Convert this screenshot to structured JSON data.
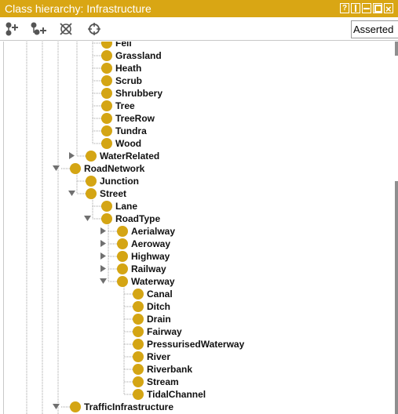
{
  "window": {
    "title": "Class hierarchy: Infrastructure"
  },
  "toolbar": {
    "add_subclass_icon": "add-subclass-icon",
    "add_sibling_icon": "add-sibling-icon",
    "delete_class_icon": "delete-class-icon",
    "find_icon": "crosshair-icon",
    "mode_value": "Asserted"
  },
  "colors": {
    "title_bar": "#d9a614",
    "class_icon": "#d4a514"
  },
  "tree": {
    "rows": [
      {
        "label": "Fell",
        "depth": 3,
        "toggle": "none"
      },
      {
        "label": "Grassland",
        "depth": 3,
        "toggle": "none"
      },
      {
        "label": "Heath",
        "depth": 3,
        "toggle": "none"
      },
      {
        "label": "Scrub",
        "depth": 3,
        "toggle": "none"
      },
      {
        "label": "Shrubbery",
        "depth": 3,
        "toggle": "none"
      },
      {
        "label": "Tree",
        "depth": 3,
        "toggle": "none"
      },
      {
        "label": "TreeRow",
        "depth": 3,
        "toggle": "none"
      },
      {
        "label": "Tundra",
        "depth": 3,
        "toggle": "none"
      },
      {
        "label": "Wood",
        "depth": 3,
        "toggle": "none"
      },
      {
        "label": "WaterRelated",
        "depth": 2,
        "toggle": "collapsed"
      },
      {
        "label": "RoadNetwork",
        "depth": 1,
        "toggle": "expanded"
      },
      {
        "label": "Junction",
        "depth": 2,
        "toggle": "none"
      },
      {
        "label": "Street",
        "depth": 2,
        "toggle": "expanded"
      },
      {
        "label": "Lane",
        "depth": 3,
        "toggle": "none"
      },
      {
        "label": "RoadType",
        "depth": 3,
        "toggle": "expanded"
      },
      {
        "label": "Aerialway",
        "depth": 4,
        "toggle": "collapsed"
      },
      {
        "label": "Aeroway",
        "depth": 4,
        "toggle": "collapsed"
      },
      {
        "label": "Highway",
        "depth": 4,
        "toggle": "collapsed"
      },
      {
        "label": "Railway",
        "depth": 4,
        "toggle": "collapsed"
      },
      {
        "label": "Waterway",
        "depth": 4,
        "toggle": "expanded"
      },
      {
        "label": "Canal",
        "depth": 5,
        "toggle": "none"
      },
      {
        "label": "Ditch",
        "depth": 5,
        "toggle": "none"
      },
      {
        "label": "Drain",
        "depth": 5,
        "toggle": "none"
      },
      {
        "label": "Fairway",
        "depth": 5,
        "toggle": "none"
      },
      {
        "label": "PressurisedWaterway",
        "depth": 5,
        "toggle": "none"
      },
      {
        "label": "River",
        "depth": 5,
        "toggle": "none"
      },
      {
        "label": "Riverbank",
        "depth": 5,
        "toggle": "none"
      },
      {
        "label": "Stream",
        "depth": 5,
        "toggle": "none"
      },
      {
        "label": "TidalChannel",
        "depth": 5,
        "toggle": "none"
      },
      {
        "label": "TrafficInfrastructure",
        "depth": 1,
        "toggle": "expanded"
      }
    ]
  }
}
